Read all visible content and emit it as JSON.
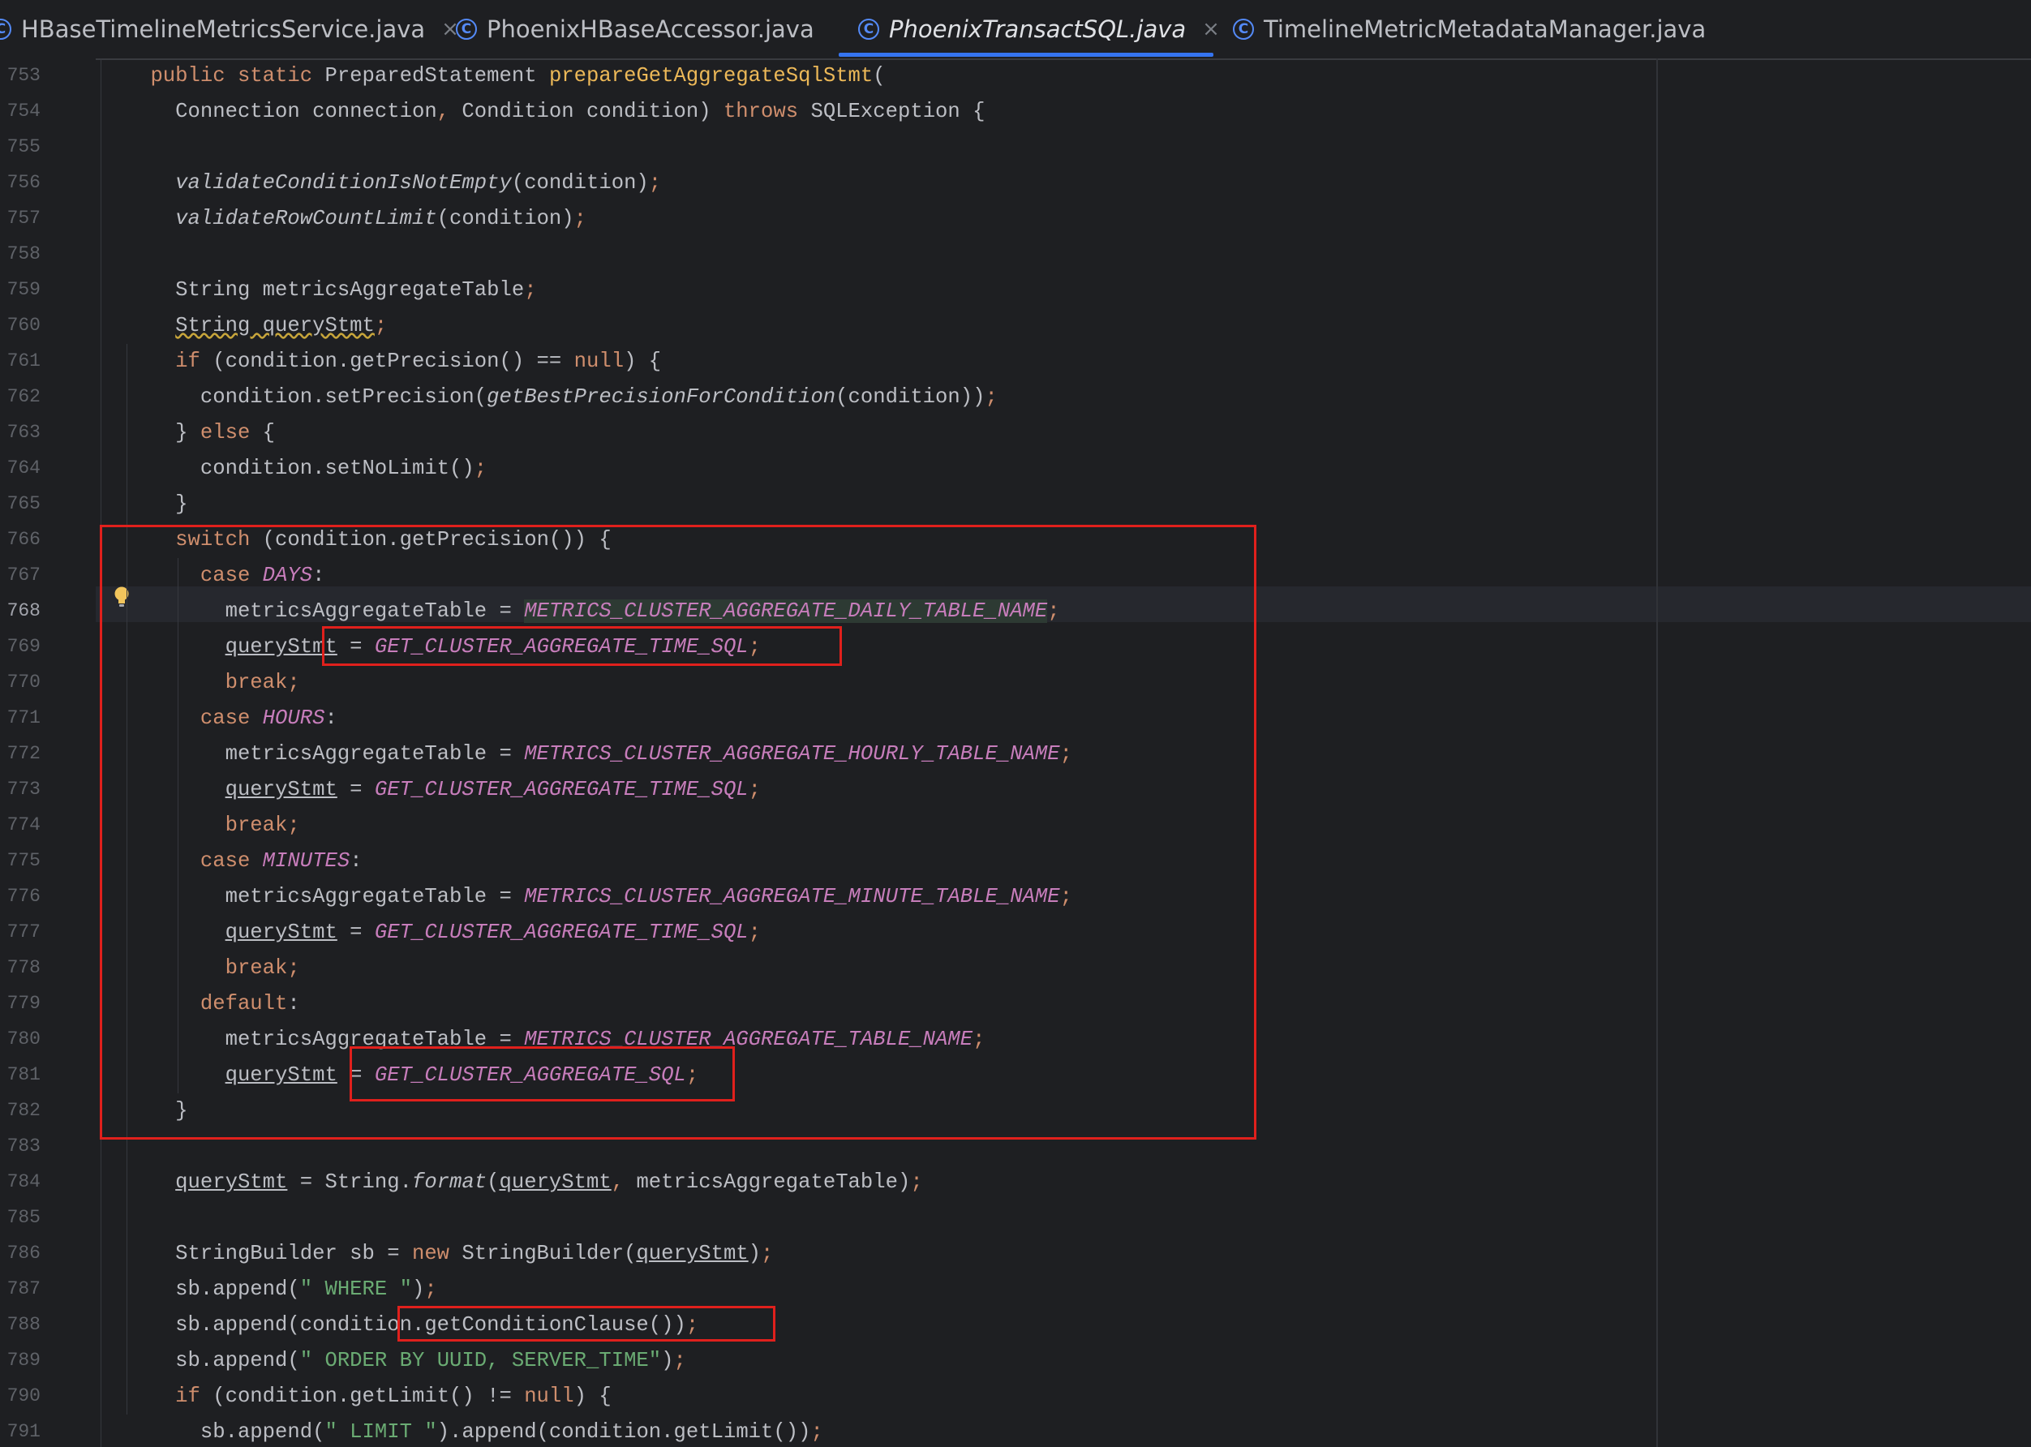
{
  "tabs": [
    {
      "label": "HBaseTimelineMetricsService.java",
      "icon": "c-class-icon",
      "closable": true,
      "active": false
    },
    {
      "label": "PhoenixHBaseAccessor.java",
      "icon": "c-class-icon",
      "closable": false,
      "active": false
    },
    {
      "label": "PhoenixTransactSQL.java",
      "icon": "c-class-icon",
      "closable": true,
      "active": true
    },
    {
      "label": "TimelineMetricMetadataManager.java",
      "icon": "c-class-icon",
      "closable": false,
      "active": false
    }
  ],
  "tab_icon_glyph": "C",
  "close_glyph": "×",
  "current_line": "768",
  "colors": {
    "background": "#1e1f22",
    "keyword": "#cf8e6d",
    "constant": "#c77dbb",
    "string": "#6aab73",
    "method_decl": "#ecb858",
    "annotation_box": "#e0201c",
    "active_tab_underline": "#3574f0"
  },
  "lines": [
    {
      "num": "753",
      "segs": [
        [
          "    ",
          ""
        ],
        [
          "public ",
          "kw"
        ],
        [
          "static ",
          "kw"
        ],
        [
          "PreparedStatement ",
          ""
        ],
        [
          "prepareGetAggregateSqlStmt",
          "fdecl"
        ],
        [
          "(",
          ""
        ]
      ]
    },
    {
      "num": "754",
      "segs": [
        [
          "      Connection connection",
          ""
        ],
        [
          ", ",
          "kw"
        ],
        [
          "Condition condition) ",
          ""
        ],
        [
          "throws ",
          "kw"
        ],
        [
          "SQLException {",
          ""
        ]
      ]
    },
    {
      "num": "755",
      "segs": []
    },
    {
      "num": "756",
      "segs": [
        [
          "      ",
          ""
        ],
        [
          "validateConditionIsNotEmpty",
          "it"
        ],
        [
          "(condition)",
          ""
        ],
        [
          ";",
          "kw"
        ]
      ]
    },
    {
      "num": "757",
      "segs": [
        [
          "      ",
          ""
        ],
        [
          "validateRowCountLimit",
          "it"
        ],
        [
          "(condition)",
          ""
        ],
        [
          ";",
          "kw"
        ]
      ]
    },
    {
      "num": "758",
      "segs": []
    },
    {
      "num": "759",
      "segs": [
        [
          "      String metricsAggregateTable",
          ""
        ],
        [
          ";",
          "kw"
        ]
      ]
    },
    {
      "num": "760",
      "segs": [
        [
          "      ",
          ""
        ],
        [
          "String queryStmt",
          "warn"
        ],
        [
          ";",
          "kw"
        ]
      ]
    },
    {
      "num": "761",
      "segs": [
        [
          "      ",
          ""
        ],
        [
          "if ",
          "kw"
        ],
        [
          "(condition.getPrecision() == ",
          ""
        ],
        [
          "null",
          "kw"
        ],
        [
          ") {",
          ""
        ]
      ]
    },
    {
      "num": "762",
      "segs": [
        [
          "        condition.setPrecision(",
          ""
        ],
        [
          "getBestPrecisionForCondition",
          "it"
        ],
        [
          "(condition))",
          ""
        ],
        [
          ";",
          "kw"
        ]
      ]
    },
    {
      "num": "763",
      "segs": [
        [
          "      } ",
          ""
        ],
        [
          "else ",
          "kw"
        ],
        [
          "{",
          ""
        ]
      ]
    },
    {
      "num": "764",
      "segs": [
        [
          "        condition.setNoLimit()",
          ""
        ],
        [
          ";",
          "kw"
        ]
      ]
    },
    {
      "num": "765",
      "segs": [
        [
          "      }",
          ""
        ]
      ]
    },
    {
      "num": "766",
      "segs": [
        [
          "      ",
          ""
        ],
        [
          "switch ",
          "kw"
        ],
        [
          "(condition.getPrecision()) {",
          ""
        ]
      ]
    },
    {
      "num": "767",
      "segs": [
        [
          "        ",
          ""
        ],
        [
          "case ",
          "kw"
        ],
        [
          "DAYS",
          "const"
        ],
        [
          ":",
          ""
        ]
      ]
    },
    {
      "num": "768",
      "segs": [
        [
          "          metricsAggregateTable = ",
          ""
        ],
        [
          "METRICS_CLUSTER_AGGREGATE_DAILY_TABLE_NAME",
          "const hl-read"
        ],
        [
          ";",
          "kw"
        ]
      ]
    },
    {
      "num": "769",
      "segs": [
        [
          "          ",
          ""
        ],
        [
          "queryStmt",
          "ul"
        ],
        [
          " = ",
          ""
        ],
        [
          "GET_CLUSTER_AGGREGATE_TIME_SQL",
          "const"
        ],
        [
          ";",
          "kw"
        ]
      ]
    },
    {
      "num": "770",
      "segs": [
        [
          "          ",
          ""
        ],
        [
          "break",
          "kw"
        ],
        [
          ";",
          "kw"
        ]
      ]
    },
    {
      "num": "771",
      "segs": [
        [
          "        ",
          ""
        ],
        [
          "case ",
          "kw"
        ],
        [
          "HOURS",
          "const"
        ],
        [
          ":",
          ""
        ]
      ]
    },
    {
      "num": "772",
      "segs": [
        [
          "          metricsAggregateTable = ",
          ""
        ],
        [
          "METRICS_CLUSTER_AGGREGATE_HOURLY_TABLE_NAME",
          "const"
        ],
        [
          ";",
          "kw"
        ]
      ]
    },
    {
      "num": "773",
      "segs": [
        [
          "          ",
          ""
        ],
        [
          "queryStmt",
          "ul"
        ],
        [
          " = ",
          ""
        ],
        [
          "GET_CLUSTER_AGGREGATE_TIME_SQL",
          "const"
        ],
        [
          ";",
          "kw"
        ]
      ]
    },
    {
      "num": "774",
      "segs": [
        [
          "          ",
          ""
        ],
        [
          "break",
          "kw"
        ],
        [
          ";",
          "kw"
        ]
      ]
    },
    {
      "num": "775",
      "segs": [
        [
          "        ",
          ""
        ],
        [
          "case ",
          "kw"
        ],
        [
          "MINUTES",
          "const"
        ],
        [
          ":",
          ""
        ]
      ]
    },
    {
      "num": "776",
      "segs": [
        [
          "          metricsAggregateTable = ",
          ""
        ],
        [
          "METRICS_CLUSTER_AGGREGATE_MINUTE_TABLE_NAME",
          "const"
        ],
        [
          ";",
          "kw"
        ]
      ]
    },
    {
      "num": "777",
      "segs": [
        [
          "          ",
          ""
        ],
        [
          "queryStmt",
          "ul"
        ],
        [
          " = ",
          ""
        ],
        [
          "GET_CLUSTER_AGGREGATE_TIME_SQL",
          "const"
        ],
        [
          ";",
          "kw"
        ]
      ]
    },
    {
      "num": "778",
      "segs": [
        [
          "          ",
          ""
        ],
        [
          "break",
          "kw"
        ],
        [
          ";",
          "kw"
        ]
      ]
    },
    {
      "num": "779",
      "segs": [
        [
          "        ",
          ""
        ],
        [
          "default",
          "kw"
        ],
        [
          ":",
          ""
        ]
      ]
    },
    {
      "num": "780",
      "segs": [
        [
          "          metricsAggregateTable = ",
          ""
        ],
        [
          "METRICS_CLUSTER_AGGREGATE_TABLE_NAME",
          "const"
        ],
        [
          ";",
          "kw"
        ]
      ]
    },
    {
      "num": "781",
      "segs": [
        [
          "          ",
          ""
        ],
        [
          "queryStmt",
          "ul"
        ],
        [
          " = ",
          ""
        ],
        [
          "GET_CLUSTER_AGGREGATE_SQL",
          "const"
        ],
        [
          ";",
          "kw"
        ]
      ]
    },
    {
      "num": "782",
      "segs": [
        [
          "      }",
          ""
        ]
      ]
    },
    {
      "num": "783",
      "segs": []
    },
    {
      "num": "784",
      "segs": [
        [
          "      ",
          ""
        ],
        [
          "queryStmt",
          "ul"
        ],
        [
          " = String.",
          ""
        ],
        [
          "format",
          "it"
        ],
        [
          "(",
          ""
        ],
        [
          "queryStmt",
          "ul"
        ],
        [
          ", ",
          "kw"
        ],
        [
          "metricsAggregateTable)",
          ""
        ],
        [
          ";",
          "kw"
        ]
      ]
    },
    {
      "num": "785",
      "segs": []
    },
    {
      "num": "786",
      "segs": [
        [
          "      StringBuilder sb = ",
          ""
        ],
        [
          "new ",
          "kw"
        ],
        [
          "StringBuilder(",
          ""
        ],
        [
          "queryStmt",
          "ul"
        ],
        [
          ")",
          ""
        ],
        [
          ";",
          "kw"
        ]
      ]
    },
    {
      "num": "787",
      "segs": [
        [
          "      sb.append(",
          ""
        ],
        [
          "\" WHERE \"",
          "str"
        ],
        [
          ")",
          ""
        ],
        [
          ";",
          "kw"
        ]
      ]
    },
    {
      "num": "788",
      "segs": [
        [
          "      sb.append(condition.getConditionClause())",
          ""
        ],
        [
          ";",
          "kw"
        ]
      ]
    },
    {
      "num": "789",
      "segs": [
        [
          "      sb.append(",
          ""
        ],
        [
          "\" ORDER BY UUID, SERVER_TIME\"",
          "str"
        ],
        [
          ")",
          ""
        ],
        [
          ";",
          "kw"
        ]
      ]
    },
    {
      "num": "790",
      "segs": [
        [
          "      ",
          ""
        ],
        [
          "if ",
          "kw"
        ],
        [
          "(condition.getLimit() != ",
          ""
        ],
        [
          "null",
          "kw"
        ],
        [
          ") {",
          ""
        ]
      ]
    },
    {
      "num": "791",
      "segs": [
        [
          "        sb.append(",
          ""
        ],
        [
          "\" LIMIT \"",
          "str"
        ],
        [
          ").append(condition.getLimit())",
          ""
        ],
        [
          ";",
          "kw"
        ]
      ]
    }
  ]
}
